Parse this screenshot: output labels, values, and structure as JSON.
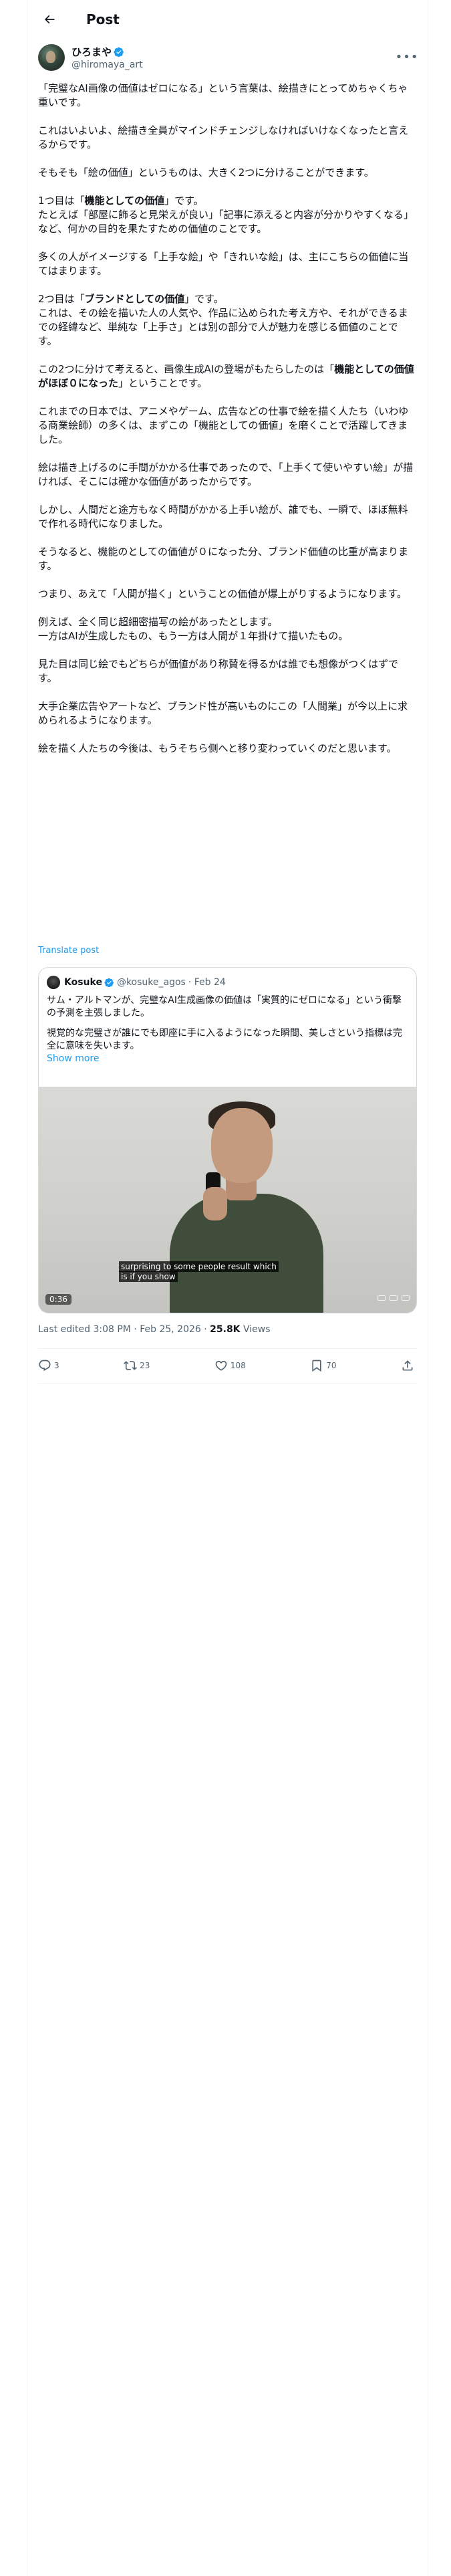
{
  "header": {
    "title": "Post"
  },
  "author": {
    "display_name": "ひろまや",
    "handle": "@hiromaya_art"
  },
  "tweet": {
    "paragraphs": [
      "「完璧なAI画像の価値はゼロになる」という言葉は、絵描きにとってめちゃくちゃ重いです。",
      "これはいよいよ、絵描き全員がマインドチェンジしなければいけなくなったと言えるからです。",
      "そもそも「絵の価値」というものは、大きく2つに分けることができます。",
      "多くの人がイメージする「上手な絵」や「きれいな絵」は、主にこちらの価値に当てはまります。",
      "つまり、あえて「人間が描く」ということの価値が爆上がりするようになります。",
      "例えば、全く同じ超細密描写の絵があったとします。\n一方はAIが生成したもの、もう一方は人間が１年掛けて描いたもの。",
      "見た目は同じ絵でもどちらが価値があり称賛を得るかは誰でも想像がつくはずです。",
      "大手企業広告やアートなど、ブランド性が高いものにこの「人間業」が今以上に求められるようになります。",
      "絵を描く人たちの今後は、もうそちら側へと移り変わっていくのだと思います。"
    ],
    "func_value": {
      "prefix": "1つ目は「",
      "bold": "機能としての価値",
      "suffix": "」です。",
      "detail": "たとえば「部屋に飾ると見栄えが良い」「記事に添えると内容が分かりやすくなる」など、何かの目的を果たすための価値のことです。"
    },
    "brand_value": {
      "prefix": "2つ目は「",
      "bold": "ブランドとしての価値",
      "suffix": "」です。",
      "detail": "これは、その絵を描いた人の人気や、作品に込められた考え方や、それができるまでの経緯など、単純な「上手さ」とは別の部分で人が魅力を感じる価値のことです。"
    },
    "ai_effect": {
      "prefix": "この2つに分けて考えると、画像生成AIの登場がもたらしたのは「",
      "bold": "機能としての価値がほぼ０になった",
      "suffix": "」ということです。"
    },
    "history": "これまでの日本では、アニメやゲーム、広告などの仕事で絵を描く人たち（いわゆる商業絵師）の多くは、まずこの「機能としての価値」を磨くことで活躍してきました。",
    "cost": "絵は描き上げるのに手間がかかる仕事であったので、「上手くて使いやすい絵」が描ければ、そこには確かな価値があったからです。",
    "now": "しかし、人間だと途方もなく時間がかかる上手い絵が、誰でも、一瞬で、ほぼ無料で作れる時代になりました。",
    "shift": "そうなると、機能のとしての価値が０になった分、ブランド価値の比重が高まります。",
    "translate": "Translate post"
  },
  "quote": {
    "display_name": "Kosuke",
    "handle": "@kosuke_agos",
    "date": "· Feb 24",
    "line1": "サム・アルトマンが、完璧なAI生成画像の価値は「実質的にゼロになる」という衝撃の予測を主張しました。",
    "line2": "視覚的な完璧さが誰にでも即座に手に入るようになった瞬間、美しさという指標は完全に意味を失います。",
    "show_more": "Show more",
    "video_subtitle_1": "surprising to some people result which",
    "video_subtitle_2": "is if you show",
    "video_time": "0:36"
  },
  "meta": {
    "edited": "Last edited 3:08 PM · Feb 25, 2026 · ",
    "views_count": "25.8K",
    "views_label": " Views"
  },
  "actions": {
    "replies": "3",
    "reposts": "23",
    "likes": "108",
    "bookmarks": "70"
  },
  "colors": {
    "accent": "#1d9bf0",
    "secondary_text": "#536471",
    "border": "#cfd9de"
  }
}
